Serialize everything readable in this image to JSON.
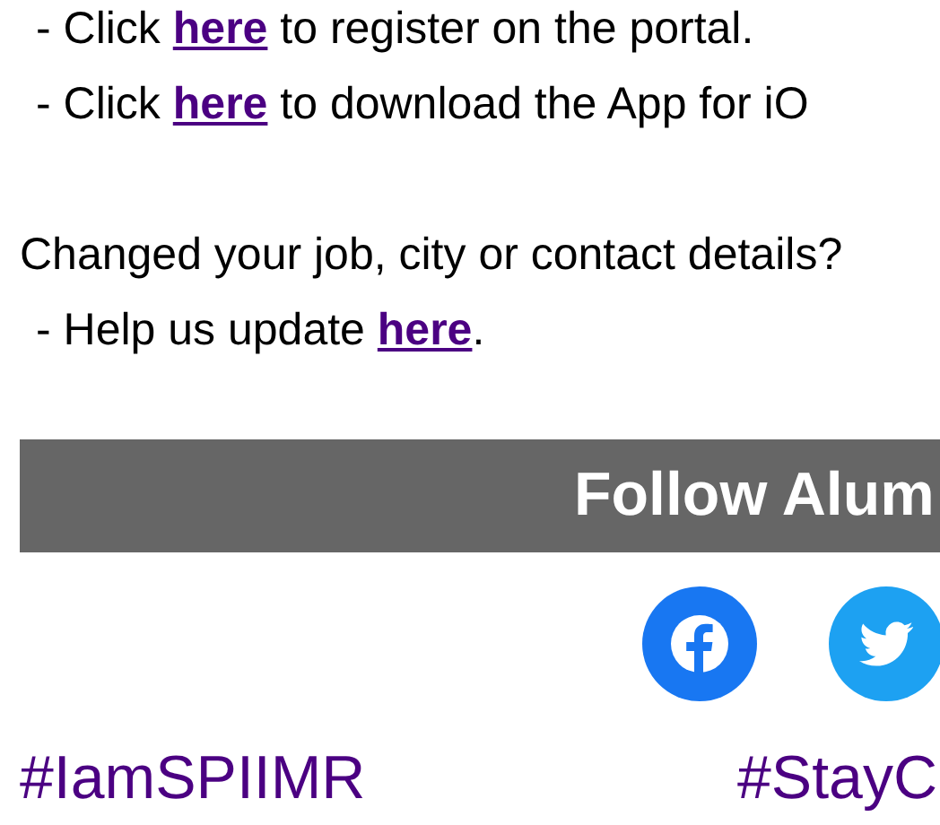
{
  "app_links": [
    {
      "before": "- Click ",
      "link": "here",
      "after": " to register on the portal."
    },
    {
      "before": "- Click ",
      "link": "here",
      "after": " to download the App for iO"
    }
  ],
  "update": {
    "question": "Changed your job, city or contact details?",
    "line": {
      "before": "- Help us update ",
      "link": "here",
      "after": "."
    }
  },
  "follow_banner": {
    "title": "Follow Alum"
  },
  "social": [
    {
      "kind": "facebook"
    },
    {
      "kind": "twitter"
    }
  ],
  "hashtags": [
    "#IamSPIIMR",
    "#StayC"
  ]
}
